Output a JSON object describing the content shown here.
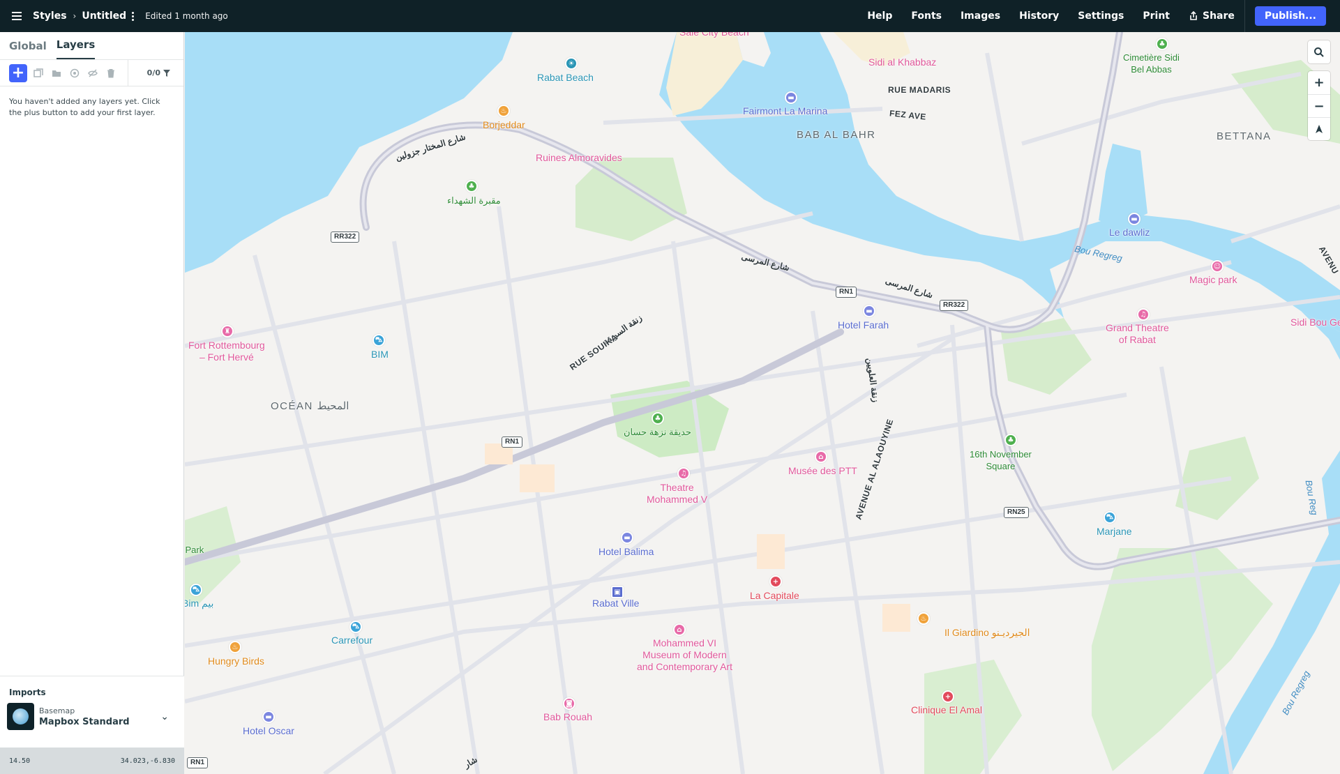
{
  "header": {
    "breadcrumb_root": "Styles",
    "style_name": "Untitled",
    "edited": "Edited 1 month ago",
    "nav": [
      "Help",
      "Fonts",
      "Images",
      "History",
      "Settings",
      "Print"
    ],
    "share_label": "Share",
    "publish_label": "Publish..."
  },
  "sidebar": {
    "tabs": [
      "Global",
      "Layers"
    ],
    "active_tab": "Layers",
    "layer_count": "0/0",
    "empty_message": "You haven't added any layers yet. Click the plus button to add your first layer.",
    "imports_title": "Imports",
    "import_kind": "Basemap",
    "import_name": "Mapbox Standard"
  },
  "status": {
    "zoom": "14.50",
    "coords": "34.023,-6.830"
  },
  "map": {
    "colors": {
      "water": "#a8def7",
      "land": "#f4f3f1",
      "park": "#cdebc4",
      "road": "#d9dde6",
      "major_road": "#bdbed0"
    },
    "pois": {
      "sale_city_beach": "Salé City Beach",
      "sidi_al_khabbaz": "Sidi al Khabbaz",
      "rabat_beach": "Rabat Beach",
      "fairmont": "Fairmont La Marina",
      "cimetiere": "Cimetière Sidi\nBel Abbas",
      "borjeddar": "Borjeddar",
      "ruines": "Ruines Almoravides",
      "martyrs_cemetery": "مقبرة الشهداء",
      "le_dawliz": "Le dawliz",
      "magic_park": "Magic park",
      "grand_theatre": "Grand Theatre\nof Rabat",
      "sidi_bou": "Sidi Bou Ge",
      "hotel_farah": "Hotel Farah",
      "fort": "Fort Rottembourg\n– Fort Hervé",
      "bim1": "BIM",
      "nouzha": "حديقة نزهة حسان",
      "musee_ptt": "Musée des PTT",
      "theatre_m5": "Theatre\nMohammed V",
      "november_square": "16th November\nSquare",
      "marjane": "Marjane",
      "hotel_balima": "Hotel Balima",
      "park_l": "l Park",
      "bim2": "Bim بيم",
      "rabat_ville": "Rabat Ville",
      "la_capitale": "La Capitale",
      "il_giardino": "Il Giardino الجيرديـنو",
      "carrefour": "Carrefour",
      "hungry_birds": "Hungry Birds",
      "museum_modern": "Mohammed VI\nMuseum of Modern\nand Contemporary Art",
      "bab_rouah": "Bab Rouah",
      "clinique": "Clinique El Amal",
      "hotel_oscar": "Hotel Oscar"
    },
    "districts": {
      "bab_al_bahr": "BAB AL BAHR",
      "bettana": "BETTANA",
      "ocean": "OCÉAN المحيط"
    },
    "streets": {
      "rue_madaris": "RUE MADARIS",
      "fez_ave": "FEZ AVE",
      "mokhtar": "شارع المختار جزولين",
      "marsa1": "شارع المرسى",
      "marsa2": "شارع المرسى",
      "souika_ar": "زنقة السويقة",
      "souika": "RUE SOUIKA",
      "alaouyine_ar": "زنقة العلويين",
      "alaouyine": "AVENUE AL ALAOUYINE",
      "avenue_r": "AVENU",
      "bottom_ar": "شار"
    },
    "water": {
      "bou_regreg1": "Bou Regreg",
      "bou_regreg2": "Bou Regreg",
      "bou_regreg3": "Bou Reg"
    },
    "shields": [
      "RR322",
      "RN1",
      "RR322",
      "RN1",
      "RN25",
      "RN1"
    ]
  },
  "controls": {
    "zoom_in": "+",
    "zoom_out": "−"
  }
}
